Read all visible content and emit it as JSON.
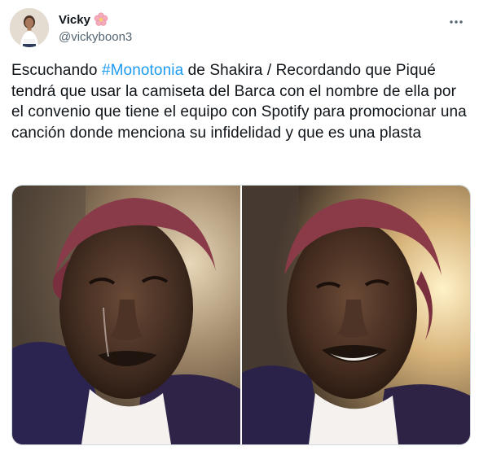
{
  "user": {
    "display_name": "Vicky",
    "handle": "@vickyboon3",
    "name_emoji_icon": "cherry-blossom-icon"
  },
  "tweet": {
    "text_before_hashtag": "Escuchando ",
    "hashtag": "#Monotonia",
    "text_after_hashtag": " de Shakira / Recordando que Piqué tendrá que usar la camiseta del Barca con el nombre de ella por el convenio que tiene el equipo con Spotify para promocionar una canción donde menciona su infidelidad y que es una plasta"
  },
  "media": {
    "photos": [
      {
        "semantic": "crying-man-photo"
      },
      {
        "semantic": "smiling-man-photo"
      }
    ]
  },
  "colors": {
    "text": "#0f1419",
    "secondary": "#536471",
    "link": "#1d9bf0",
    "border": "#cfd9de"
  }
}
